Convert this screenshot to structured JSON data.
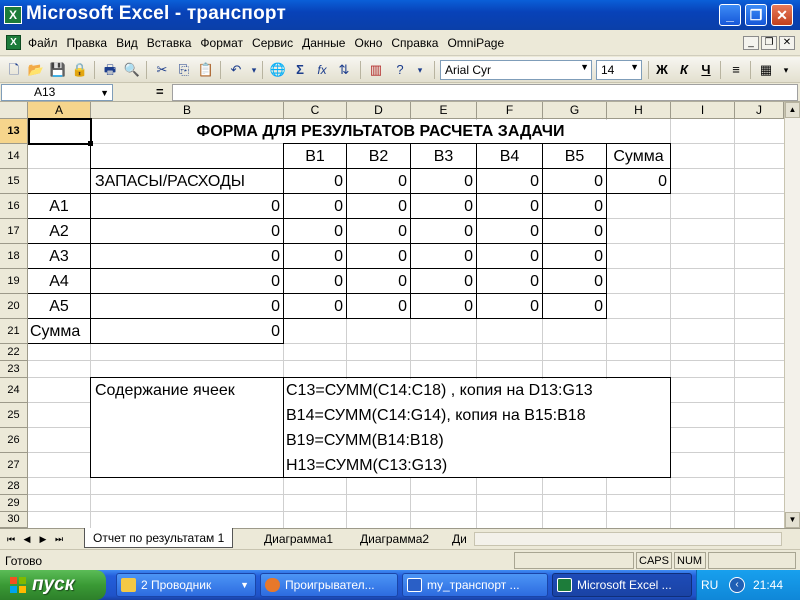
{
  "window": {
    "title": "Microsoft Excel - транспорт",
    "app_icon": "X",
    "controls": {
      "minimize": "_",
      "maximize": "❐",
      "close": "✕"
    }
  },
  "menubar": {
    "doc_icon": "X",
    "items": [
      "Файл",
      "Правка",
      "Вид",
      "Вставка",
      "Формат",
      "Сервис",
      "Данные",
      "Окно",
      "Справка",
      "OmniPage"
    ],
    "mdi": {
      "minimize": "_",
      "restore": "❐",
      "close": "✕"
    }
  },
  "toolbar": {
    "font_name": "Arial Cyr",
    "font_size": "14",
    "bold": "Ж",
    "italic": "К",
    "underline": "Ч",
    "autosum": "Σ",
    "function": "fx"
  },
  "formula_bar": {
    "name_box": "A13",
    "fx_label": "=",
    "formula": ""
  },
  "sheet": {
    "columns": [
      "A",
      "B",
      "C",
      "D",
      "E",
      "F",
      "G",
      "H",
      "I",
      "J"
    ],
    "rows": [
      "13",
      "14",
      "15",
      "16",
      "17",
      "18",
      "19",
      "20",
      "21",
      "22",
      "23",
      "24",
      "25",
      "26",
      "27",
      "28",
      "29",
      "30"
    ],
    "title": "ФОРМА ДЛЯ РЕЗУЛЬТАТОВ РАСЧЕТА ЗАДАЧИ",
    "header_row": [
      "B1",
      "B2",
      "B3",
      "B4",
      "B5",
      "Сумма"
    ],
    "supply_label": "ЗАПАСЫ/РАСХОДЫ",
    "supply_values": [
      "0",
      "0",
      "0",
      "0",
      "0",
      "0"
    ],
    "row_labels": [
      "A1",
      "A2",
      "A3",
      "A4",
      "A5"
    ],
    "b_values": [
      "0",
      "0",
      "0",
      "0",
      "0"
    ],
    "matrix": [
      [
        "0",
        "0",
        "0",
        "0",
        "0"
      ],
      [
        "0",
        "0",
        "0",
        "0",
        "0"
      ],
      [
        "0",
        "0",
        "0",
        "0",
        "0"
      ],
      [
        "0",
        "0",
        "0",
        "0",
        "0"
      ],
      [
        "0",
        "0",
        "0",
        "0",
        "0"
      ]
    ],
    "sum_label": "Сумма",
    "sum_value": "0",
    "contents_label": "Содержание ячеек",
    "formulas": [
      "C13=СУММ(C14:C18) , копия на D13:G13",
      "B14=СУММ(C14:G14), копия на B15:B18",
      "B19=СУММ(B14:B18)",
      "H13=СУММ(C13:G13)"
    ]
  },
  "tabs": {
    "items": [
      "Отчет по результатам 1",
      "Диаграмма1",
      "Диаграмма2",
      "Ди"
    ],
    "active": 0
  },
  "status": {
    "ready": "Готово",
    "caps": "CAPS",
    "num": "NUM"
  },
  "taskbar": {
    "start": "пуск",
    "tasks": [
      "2 Проводник",
      "Проигрывател...",
      "my_транспорт ...",
      "Microsoft Excel ..."
    ],
    "language": "RU",
    "clock": "21:44"
  }
}
